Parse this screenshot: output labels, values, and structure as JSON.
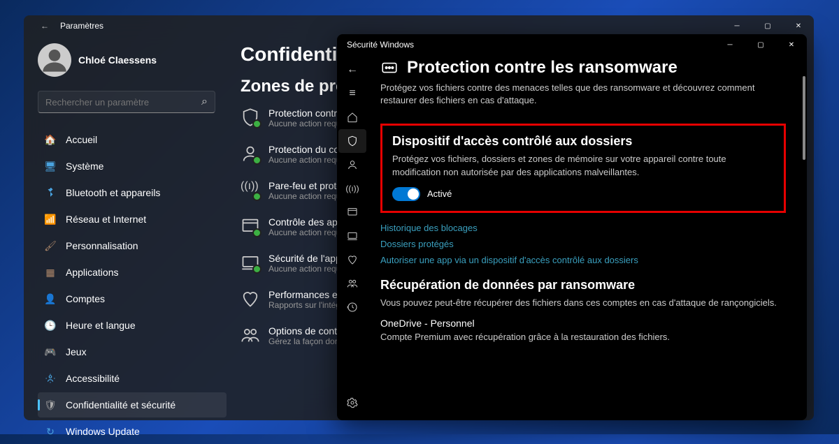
{
  "settings": {
    "window_title": "Paramètres",
    "user_name": "Chloé Claessens",
    "user_email": "",
    "search_placeholder": "Rechercher un paramètre",
    "nav": [
      {
        "icon": "🏠",
        "label": "Accueil",
        "color": "#e07b39"
      },
      {
        "icon": "🖥",
        "label": "Système",
        "color": "#4aa3df"
      },
      {
        "icon": "bt",
        "label": "Bluetooth et appareils",
        "color": "#4aa3df"
      },
      {
        "icon": "📶",
        "label": "Réseau et Internet",
        "color": "#4aa3df"
      },
      {
        "icon": "🖌",
        "label": "Personnalisation",
        "color": "#b0896b"
      },
      {
        "icon": "▦",
        "label": "Applications",
        "color": "#b0896b"
      },
      {
        "icon": "👤",
        "label": "Comptes",
        "color": "#e07b39"
      },
      {
        "icon": "🕒",
        "label": "Heure et langue",
        "color": "#b0896b"
      },
      {
        "icon": "🎮",
        "label": "Jeux",
        "color": "#4aa3df"
      },
      {
        "icon": "acc",
        "label": "Accessibilité",
        "color": "#4aa3df"
      },
      {
        "icon": "🛡",
        "label": "Confidentialité et sécurité",
        "color": "#aaa"
      },
      {
        "icon": "↻",
        "label": "Windows Update",
        "color": "#4aa3df"
      }
    ],
    "nav_active": 10,
    "page_title": "Confidentialité et sécurité",
    "section_title": "Zones de protection",
    "zones": [
      {
        "label": "Protection contre les virus et menaces",
        "sub": "Aucune action requise."
      },
      {
        "label": "Protection du compte",
        "sub": "Aucune action requise."
      },
      {
        "label": "Pare-feu et protection réseau",
        "sub": "Aucune action requise."
      },
      {
        "label": "Contrôle des applications et du navigateur",
        "sub": "Aucune action requise."
      },
      {
        "label": "Sécurité de l'appareil",
        "sub": "Aucune action requise."
      },
      {
        "label": "Performances et intégrité de l'appareil",
        "sub": "Rapports sur l'intégrité de votre appareil."
      },
      {
        "label": "Options de contrôle parental",
        "sub": "Gérez la façon dont votre famille utilise ses périphériques."
      }
    ]
  },
  "security": {
    "window_title": "Sécurité Windows",
    "page_title": "Protection contre les ransomware",
    "page_desc": "Protégez vos fichiers contre des menaces telles que des ransomware et découvrez comment restaurer des fichiers en cas d'attaque.",
    "cfa_title": "Dispositif d'accès contrôlé aux dossiers",
    "cfa_desc": "Protégez vos fichiers, dossiers et zones de mémoire sur votre appareil contre toute modification non autorisée par des applications malveillantes.",
    "toggle_state": "Activé",
    "links": [
      "Historique des blocages",
      "Dossiers protégés",
      "Autoriser une app via un dispositif d'accès contrôlé aux dossiers"
    ],
    "recovery_title": "Récupération de données par ransomware",
    "recovery_desc": "Vous pouvez peut-être récupérer des fichiers dans ces comptes en cas d'attaque de rançongiciels.",
    "account_name": "OneDrive - Personnel",
    "account_email": "",
    "account_desc": "Compte Premium avec récupération grâce à la restauration des fichiers."
  }
}
